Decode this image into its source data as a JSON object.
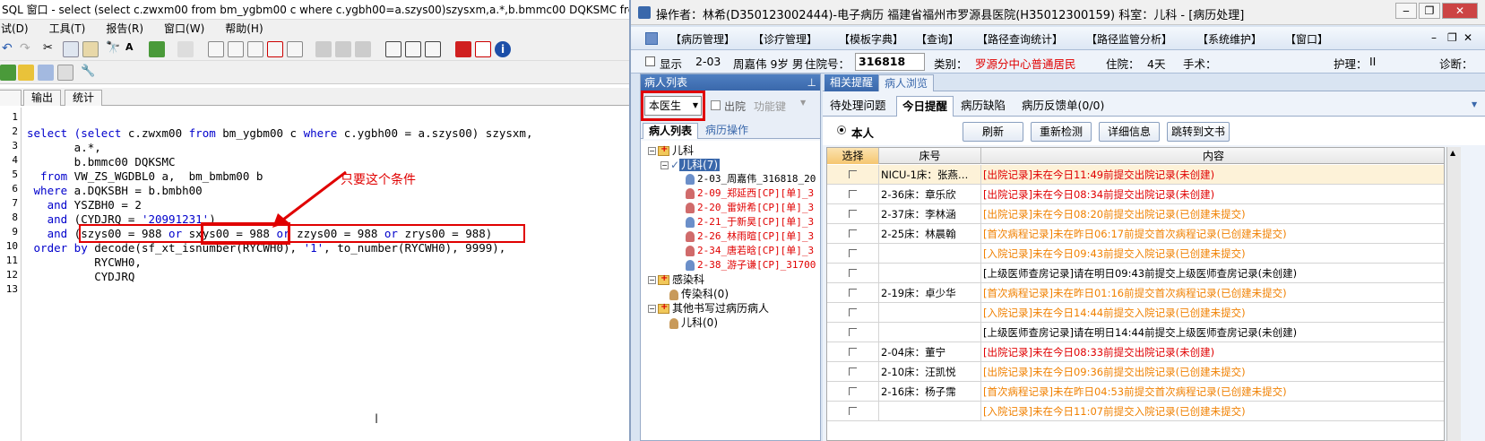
{
  "sql": {
    "title": "SQL 窗口 - select (select c.zwxm00 from bm_ygbm00 c where c.ygbh00=a.szys00)szysxm,a.*,b.bmmc00 DQKSMC from ...",
    "menus": [
      "试(D)",
      "工具(T)",
      "报告(R)",
      "窗口(W)",
      "帮助(H)"
    ],
    "tabs": [
      "输出",
      "统计"
    ],
    "line_numbers": [
      "1",
      "2",
      "3",
      "4",
      "5",
      "6",
      "7",
      "8",
      "9",
      "10",
      "11",
      "12",
      "13"
    ],
    "code": {
      "l2a": "select (",
      "l2b": "select",
      "l2c": " c.zwxm00 ",
      "l2d": "from",
      "l2e": " bm_ygbm00 c ",
      "l2f": "where",
      "l2g": " c.ygbh00 = a.szys00) szysxm,",
      "l3": "       a.*,",
      "l4": "       b.bmmc00 DQKSMC",
      "l5a": "  from",
      "l5b": " VW_ZS_WGDBL0 a,  bm_bmbm00 b",
      "l6a": " where",
      "l6b": " a.DQKSBH = b.bmbh00",
      "l7a": "   and",
      "l7b": " YSZBH0 = 2",
      "l8a": "   and",
      "l8b": " (CYDJRQ = ",
      "l8c": "'20991231'",
      "l8d": ")",
      "l9a": "   and",
      "l9b": " (szys00 = 988 ",
      "l9c": "or",
      "l9d": " ",
      "l9e": "sxys00 = 988",
      "l9f": " ",
      "l9g": "or",
      "l9h": " zzys00 = 988 ",
      "l9i": "or",
      "l9j": " zrys00 = 988)",
      "l10a": " order by",
      "l10b": " decode(sf_xt_isnumber(RYCWH0), ",
      "l10c": "'1'",
      "l10d": ", to_number(RYCWH0), 9999),",
      "l11": "          RYCWH0,",
      "l12": "          CYDJRQ"
    },
    "annotation": "只要这个条件"
  },
  "emr": {
    "title": "操作者：林希(D350123002444)-电子病历  福建省福州市罗源县医院(H35012300159)  科室：儿科 - [病历处理]",
    "menus": [
      "【病历管理】",
      "【诊疗管理】",
      "【模板字典】",
      "【查询】",
      "【路径查询统计】",
      "【路径监管分析】",
      "【系统维护】",
      "【窗口】"
    ],
    "info": {
      "show_label": "显示",
      "bed": "2-03",
      "patient": "周嘉伟 9岁 男",
      "adm_label": "住院号：",
      "adm_no": "316818",
      "category_label": "类别：",
      "category": "罗源分中心普通居民",
      "stay_label": "住院：",
      "stay": "4天",
      "surgery_label": "手术：",
      "care_label": "护理：",
      "care": "II",
      "diag_label": "诊断："
    },
    "left_panel": {
      "header": "病人列表",
      "doctor_select": "本医生",
      "discharge_label": "出院",
      "func_label": "功能键",
      "tabs": [
        "病人列表",
        "病历操作"
      ],
      "tree": {
        "root": "儿科",
        "sub": "儿科(7)",
        "patients": [
          "2-03_周嘉伟_316818_20",
          "2-09_郑延西[CP][单]_3",
          "2-20_雷妍希[CP][单]_3",
          "2-21_于新昊[CP][单]_3",
          "2-26_林雨暄[CP][单]_3",
          "2-34_唐若晗[CP][单]_3",
          "2-38_游子谦[CP]_31700"
        ],
        "infect": "感染科",
        "infect_sub": "传染科(0)",
        "other": "其他书写过病历病人",
        "other_sub": "儿科(0)"
      }
    },
    "right_panel": {
      "tabs1": [
        "相关提醒",
        "病人浏览"
      ],
      "tabs2": [
        "待处理问题",
        "今日提醒",
        "病历缺陷",
        "病历反馈单(0/0)"
      ],
      "radio_label": "本人",
      "buttons": [
        "刷新",
        "重新检测",
        "详细信息",
        "跳转到文书"
      ],
      "columns": [
        "选择",
        "床号",
        "内容"
      ],
      "rows": [
        {
          "bed": "NICU-1床：张燕…",
          "content": "[出院记录]未在今日11:49前提交出院记录(未创建)",
          "color": "#e00000"
        },
        {
          "bed": "2-36床：章乐欣",
          "content": "[出院记录]未在今日08:34前提交出院记录(未创建)",
          "color": "#e00000"
        },
        {
          "bed": "2-37床：李林涵",
          "content": "[出院记录]未在今日08:20前提交出院记录(已创建未提交)",
          "color": "#f08000"
        },
        {
          "bed": "2-25床：林晨翰",
          "content": "[首次病程记录]未在昨日06:17前提交首次病程记录(已创建未提交)",
          "color": "#f08000"
        },
        {
          "bed": "",
          "content": "[入院记录]未在今日09:43前提交入院记录(已创建未提交)",
          "color": "#f08000"
        },
        {
          "bed": "",
          "content": "[上级医师查房记录]请在明日09:43前提交上级医师查房记录(未创建)",
          "color": "#000000"
        },
        {
          "bed": "2-19床：卓少华",
          "content": "[首次病程记录]未在昨日01:16前提交首次病程记录(已创建未提交)",
          "color": "#f08000"
        },
        {
          "bed": "",
          "content": "[入院记录]未在今日14:44前提交入院记录(已创建未提交)",
          "color": "#f08000"
        },
        {
          "bed": "",
          "content": "[上级医师查房记录]请在明日14:44前提交上级医师查房记录(未创建)",
          "color": "#000000"
        },
        {
          "bed": "2-04床：董宁",
          "content": "[出院记录]未在今日08:33前提交出院记录(未创建)",
          "color": "#e00000"
        },
        {
          "bed": "2-10床：汪凯悦",
          "content": "[出院记录]未在今日09:36前提交出院记录(已创建未提交)",
          "color": "#f08000"
        },
        {
          "bed": "2-16床：杨子霈",
          "content": "[首次病程记录]未在昨日04:53前提交首次病程记录(已创建未提交)",
          "color": "#f08000"
        },
        {
          "bed": "",
          "content": "[入院记录]未在今日11:07前提交入院记录(已创建未提交)",
          "color": "#f08000"
        }
      ]
    }
  },
  "colors": {
    "sql_keyword": "#0000cc",
    "annotation_red": "#e00000",
    "emr_accent": "#3a68ab"
  }
}
